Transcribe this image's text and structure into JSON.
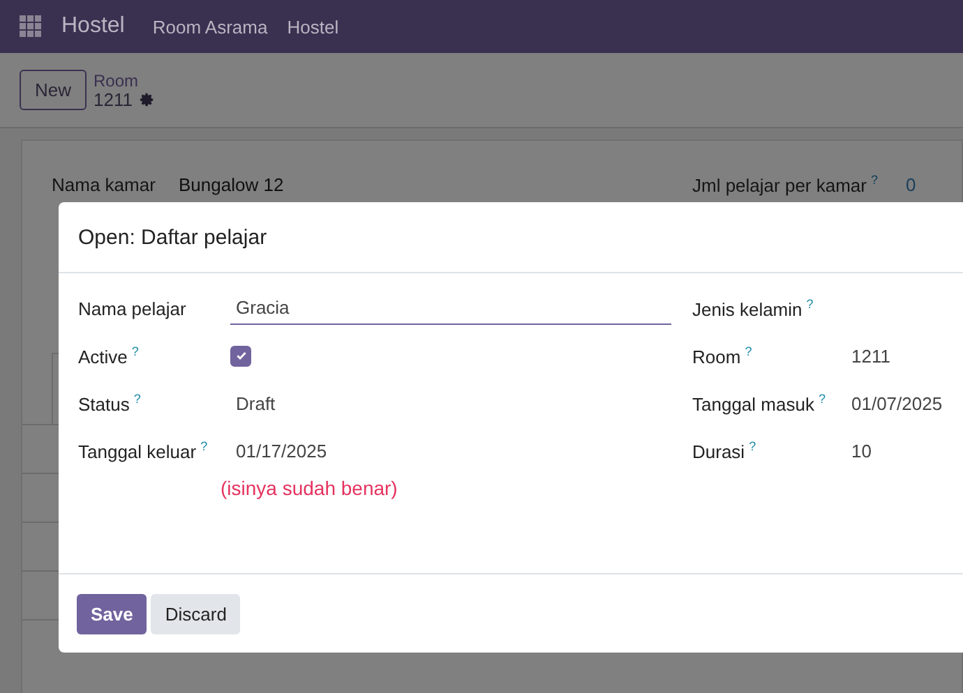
{
  "navbar": {
    "app_name": "Hostel",
    "menu": [
      {
        "label": "Room Asrama"
      },
      {
        "label": "Hostel"
      }
    ]
  },
  "control_panel": {
    "new_button": "New",
    "breadcrumb": "Room",
    "record": "1211"
  },
  "form": {
    "name_field": {
      "label": "Nama kamar",
      "value": "Bungalow 12"
    },
    "count_field": {
      "label": "Jml pelajar per kamar",
      "help": "?",
      "value": "0"
    }
  },
  "dialog": {
    "title": "Open: Daftar pelajar",
    "left_fields": [
      {
        "kind": "input",
        "label": "Nama pelajar",
        "value": "Gracia"
      },
      {
        "kind": "checkbox",
        "label": "Active",
        "help": "?",
        "checked": true
      },
      {
        "kind": "text",
        "label": "Status",
        "help": "?",
        "value": "Draft"
      },
      {
        "kind": "text",
        "label": "Tanggal keluar",
        "help": "?",
        "value": "01/17/2025"
      }
    ],
    "note": "(isinya sudah benar)",
    "right_fields": [
      {
        "kind": "text",
        "label": "Jenis kelamin",
        "help": "?"
      },
      {
        "kind": "text",
        "label": "Room",
        "help": "?",
        "value": "1211"
      },
      {
        "kind": "text",
        "label": "Tanggal masuk",
        "help": "?",
        "value": "01/07/2025"
      },
      {
        "kind": "text",
        "label": "Durasi",
        "help": "?",
        "value": "10"
      }
    ],
    "buttons": [
      {
        "kind": "primary",
        "label": "Save"
      },
      {
        "kind": "secondary",
        "label": "Discard"
      }
    ]
  }
}
